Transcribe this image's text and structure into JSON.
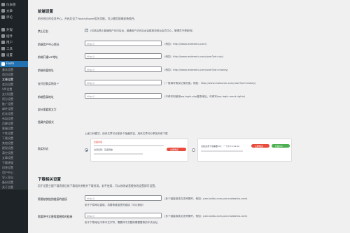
{
  "sidebar": {
    "items": [
      {
        "label": "仪表盘",
        "icon": "dashboard-icon"
      },
      {
        "label": "文章",
        "icon": "pin-icon"
      },
      {
        "label": "评论",
        "icon": "comment-icon"
      },
      {
        "label": "",
        "icon": "none"
      },
      {
        "label": "外观",
        "icon": "brush-icon"
      },
      {
        "label": "插件",
        "icon": "plugin-icon"
      },
      {
        "label": "用户",
        "icon": "user-icon"
      },
      {
        "label": "工具",
        "icon": "wrench-icon"
      },
      {
        "label": "设置",
        "icon": "settings-icon"
      }
    ],
    "active_label": "Fashi",
    "sub_items": [
      "基本设置",
      "首页设置",
      "文章设置",
      "会员设置",
      "VIP设置",
      "支付设置",
      "积分设置",
      "推广设置",
      "邮件设置",
      "优化设置",
      "布局设置",
      "页脚设置",
      "客服设置",
      "个性设置",
      "下载设置",
      "其他设置",
      "提现设置",
      "清空设置",
      "文章设置",
      "下载增强",
      "问答设置",
      "用户中心",
      "导入导出",
      "备份设置",
      "关于主题"
    ],
    "current_sub_index": 2
  },
  "section1": {
    "title": "前端设置",
    "desc": "前台独立的会员中心，开启后会了Fashiuflower相关功能，可以使用前端安装插件。",
    "rows": [
      {
        "label": "禁止后台",
        "type": "checkbox",
        "text": "(勾选后禁止普通用户访问后台，普通用户访问后台会跳转到前台会员中心，管理员不受影响)"
      },
      {
        "label": "前端用户中心地址",
        "value": "http://",
        "hint": "(例如：http://www.moleantu.com)"
      },
      {
        "label": "前端开通VIP地址",
        "value": "http://",
        "hint": "(例如：http://www.moleantu.com/user?pd=vip)"
      },
      {
        "label": "前端充值地址",
        "value": "http://",
        "hint": "(例如：http://www.moleantu.com/user?pd=money)"
      },
      {
        "label": "支付后购买地址 *",
        "value": "http://",
        "hint": "(一般填写购买记录页面，例如：http://www.moleantu.com/user?pd=history)"
      },
      {
        "label": "前端登录地址",
        "value": "http://",
        "hint": "(不填写则使用wp-login.php登录地址，可填写/wp-login-ment-rights)"
      },
      {
        "label": "部分需要需文字",
        "type": "text"
      },
      {
        "label": "隐藏内容模式",
        "type": "text"
      }
    ]
  },
  "style_section": {
    "label": "购买样式",
    "desc": "上面三种模式，用来文章可分配多个隐藏内容，用来文章可分享如何收下载",
    "option1": {
      "tag": "隐藏内容",
      "line": "资源名称：百度网盘",
      "btn": "立即购买"
    },
    "option2": {
      "text": "当前资源下载需要VIP：一个月 ¥ 199.00",
      "btn1": "立即购买",
      "btn2": "升级VIP"
    }
  },
  "section2": {
    "title": "下载相关设置",
    "desc": "用于设置主题下载资源后前下载相关参数并下载时用，若不使用，可以修改或直接修改设置即可设置。",
    "rows": [
      {
        "label": "需要被快链独链接的链接",
        "value": "http://",
        "hint": "(多个链接用英文逗号隔开，例如：pan.baidu.com,pan.moleantu.com)",
        "below": "用于下载地址直链，将替换链接里的链接（可以使用）"
      },
      {
        "label": "需要将中文替需要替换的链接",
        "value": "http://",
        "hint": "(多个链接用英文逗号隔开，例如：pan.baidu.com,pan.moleantu.com)",
        "below": "用于下载地址中带中文字符，需要将中文替换需要替换的中文地址"
      }
    ]
  },
  "colors": {
    "sidebar_bg": "#1d2327",
    "accent": "#2271b1",
    "red": "#e74c3c",
    "green": "#4caf50"
  }
}
